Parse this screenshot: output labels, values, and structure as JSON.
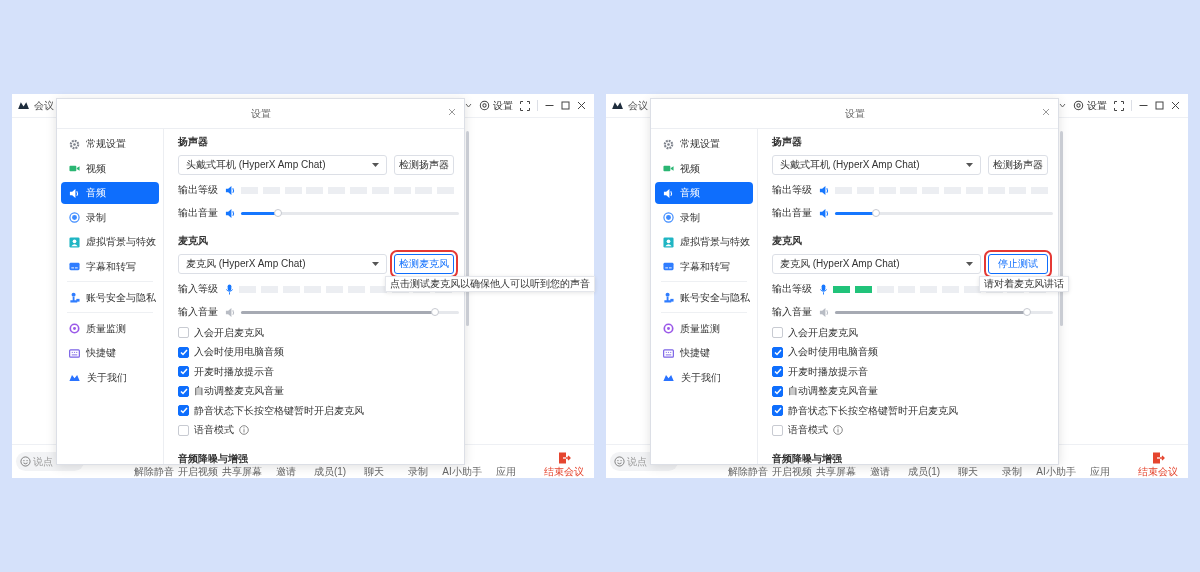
{
  "panels": [
    {
      "meeting_window": {
        "title": "会议",
        "settings_label": "设置",
        "chat_placeholder": "说点",
        "toolbar": [
          "解除静音",
          "开启视频",
          "共享屏幕",
          "邀请",
          "成员(1)",
          "聊天",
          "录制",
          "AI小助手",
          "应用"
        ],
        "end_label": "结束会议"
      },
      "dialog": {
        "title": "设置",
        "nav_groups": [
          [
            {
              "label": "常规设置",
              "selected": false
            },
            {
              "label": "视频",
              "selected": false
            },
            {
              "label": "音频",
              "selected": true
            },
            {
              "label": "录制",
              "selected": false
            },
            {
              "label": "虚拟背景与特效",
              "selected": false
            },
            {
              "label": "字幕和转写",
              "selected": false
            }
          ],
          [
            {
              "label": "账号安全与隐私",
              "selected": false
            }
          ],
          [
            {
              "label": "质量监测",
              "selected": false
            },
            {
              "label": "快捷键",
              "selected": false
            },
            {
              "label": "关于我们",
              "selected": false
            }
          ]
        ],
        "sections": [
          {
            "heading": "扬声器",
            "device": "头戴式耳机 (HyperX Amp Chat)",
            "button": {
              "label": "检测扬声器",
              "highlighted": false
            },
            "level_meter": {
              "label": "输出等级",
              "level": 0
            },
            "volume": {
              "label": "输出音量",
              "level": 0.17,
              "disabled": false
            }
          },
          {
            "heading": "麦克风",
            "device": "麦克风 (HyperX Amp Chat)",
            "button": {
              "label": "检测麦克风",
              "highlighted": true,
              "tooltip": "点击测试麦克风以确保他人可以听到您的声音"
            },
            "level_meter": {
              "label": "输入等级",
              "level": 0
            },
            "volume": {
              "label": "输入音量",
              "level": 0.89,
              "disabled": true
            }
          }
        ],
        "options": [
          {
            "label": "入会开启麦克风",
            "checked": false,
            "info": false
          },
          {
            "label": "入会时使用电脑音频",
            "checked": true,
            "info": false
          },
          {
            "label": "开麦时播放提示音",
            "checked": true,
            "info": false
          },
          {
            "label": "自动调整麦克风音量",
            "checked": true,
            "info": false
          },
          {
            "label": "静音状态下长按空格键暂时开启麦克风",
            "checked": true,
            "info": false
          },
          {
            "label": "语音模式",
            "checked": false,
            "info": true
          }
        ],
        "next_heading": "音频降噪与增强"
      }
    },
    {
      "meeting_window": {
        "title": "会议",
        "settings_label": "设置",
        "chat_placeholder": "说点",
        "toolbar": [
          "解除静音",
          "开启视频",
          "共享屏幕",
          "邀请",
          "成员(1)",
          "聊天",
          "录制",
          "AI小助手",
          "应用"
        ],
        "end_label": "结束会议"
      },
      "dialog": {
        "title": "设置",
        "nav_groups": [
          [
            {
              "label": "常规设置",
              "selected": false
            },
            {
              "label": "视频",
              "selected": false
            },
            {
              "label": "音频",
              "selected": true
            },
            {
              "label": "录制",
              "selected": false
            },
            {
              "label": "虚拟背景与特效",
              "selected": false
            },
            {
              "label": "字幕和转写",
              "selected": false
            }
          ],
          [
            {
              "label": "账号安全与隐私",
              "selected": false
            }
          ],
          [
            {
              "label": "质量监测",
              "selected": false
            },
            {
              "label": "快捷键",
              "selected": false
            },
            {
              "label": "关于我们",
              "selected": false
            }
          ]
        ],
        "sections": [
          {
            "heading": "扬声器",
            "device": "头戴式耳机 (HyperX Amp Chat)",
            "button": {
              "label": "检测扬声器",
              "highlighted": false
            },
            "level_meter": {
              "label": "输出等级",
              "level": 0
            },
            "volume": {
              "label": "输出音量",
              "level": 0.19,
              "disabled": false
            }
          },
          {
            "heading": "麦克风",
            "device": "麦克风 (HyperX Amp Chat)",
            "button": {
              "label": "停止测试",
              "highlighted": true,
              "tooltip": "请对着麦克风讲话"
            },
            "level_meter": {
              "label": "输出等级",
              "level": 0.2
            },
            "volume": {
              "label": "输入音量",
              "level": 0.88,
              "disabled": true
            }
          }
        ],
        "options": [
          {
            "label": "入会开启麦克风",
            "checked": false,
            "info": false
          },
          {
            "label": "入会时使用电脑音频",
            "checked": true,
            "info": false
          },
          {
            "label": "开麦时播放提示音",
            "checked": true,
            "info": false
          },
          {
            "label": "自动调整麦克风音量",
            "checked": true,
            "info": false
          },
          {
            "label": "静音状态下长按空格键暂时开启麦克风",
            "checked": true,
            "info": false
          },
          {
            "label": "语音模式",
            "checked": false,
            "info": true
          }
        ],
        "next_heading": "音频降噪与增强"
      }
    }
  ]
}
